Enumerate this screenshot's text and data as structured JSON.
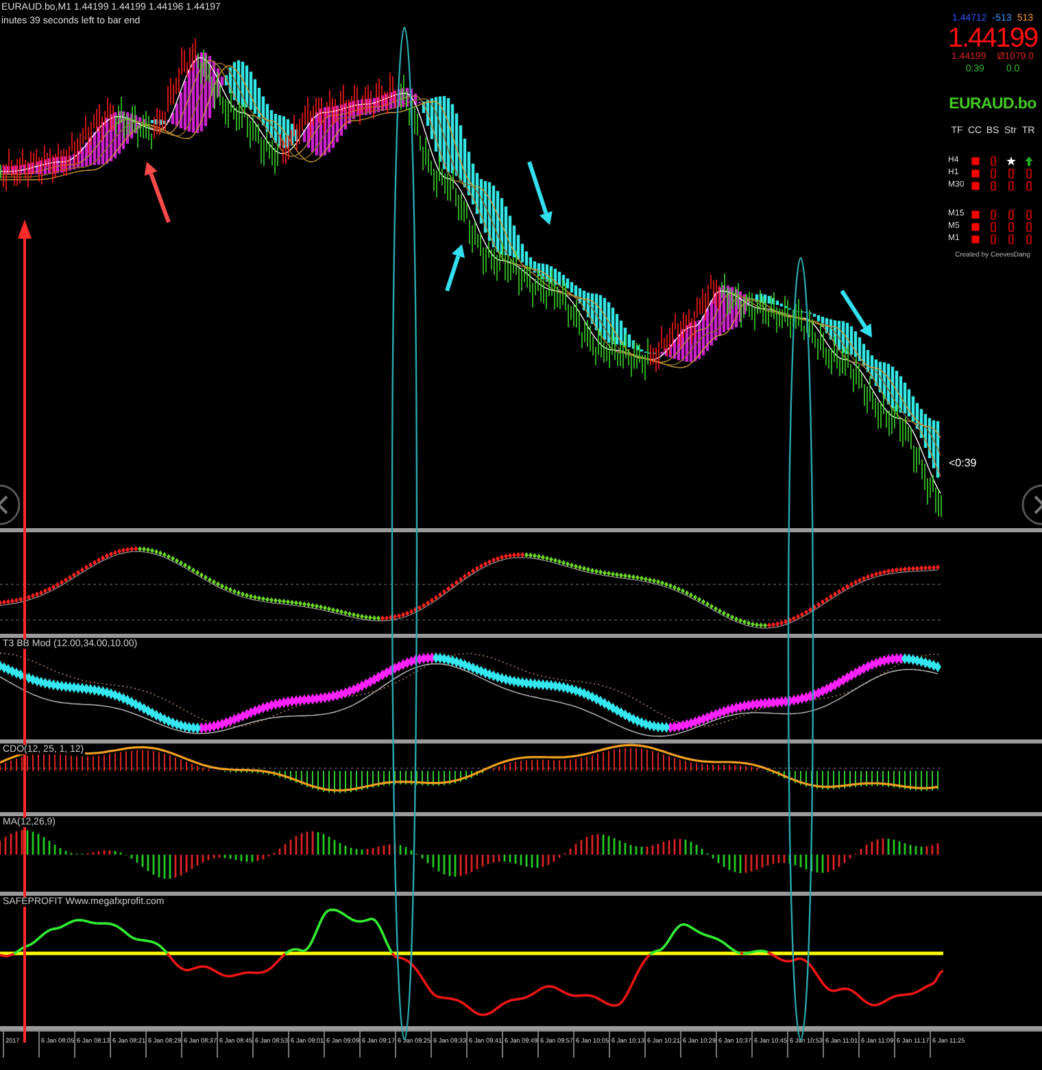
{
  "chart": {
    "symbol_line": "EURAUD.bo,M1  1.44199 1.44199 1.44196 1.44197",
    "timer_line": "inutes 39 seconds left to bar end",
    "countdown_label": "<0:39"
  },
  "info_panel": {
    "top_row": [
      "1.44712",
      "-513",
      "513"
    ],
    "price": "1.44199",
    "second_row": [
      "1.44199",
      "Ø1079.0"
    ],
    "third_row": [
      "0:39",
      "0.0"
    ],
    "symbol": "EURAUD.bo",
    "table": {
      "columns": [
        "TF",
        "CC",
        "BS",
        "Str",
        "TR"
      ],
      "groups": [
        [
          {
            "tf": "H4",
            "cells": [
              {
                "kind": "block",
                "color": "#ff0000"
              },
              {
                "kind": "mark",
                "color": "#cc0000"
              },
              {
                "kind": "star",
                "color": "#ffffff"
              },
              {
                "kind": "arrow",
                "color": "#22aa22"
              }
            ]
          },
          {
            "tf": "H1",
            "cells": [
              {
                "kind": "block",
                "color": "#ff0000"
              },
              {
                "kind": "mark",
                "color": "#cc0000"
              },
              {
                "kind": "mark",
                "color": "#cc0000"
              },
              {
                "kind": "mark",
                "color": "#cc0000"
              }
            ]
          },
          {
            "tf": "M30",
            "cells": [
              {
                "kind": "block",
                "color": "#ff0000"
              },
              {
                "kind": "mark",
                "color": "#cc0000"
              },
              {
                "kind": "mark",
                "color": "#cc0000"
              },
              {
                "kind": "mark",
                "color": "#cc0000"
              }
            ]
          }
        ],
        [
          {
            "tf": "M15",
            "cells": [
              {
                "kind": "block",
                "color": "#ff0000"
              },
              {
                "kind": "mark",
                "color": "#cc0000"
              },
              {
                "kind": "mark",
                "color": "#cc0000"
              },
              {
                "kind": "mark",
                "color": "#cc0000"
              }
            ]
          },
          {
            "tf": "M5",
            "cells": [
              {
                "kind": "block",
                "color": "#ff0000"
              },
              {
                "kind": "mark",
                "color": "#cc0000"
              },
              {
                "kind": "mark",
                "color": "#cc0000"
              },
              {
                "kind": "mark",
                "color": "#cc0000"
              }
            ]
          },
          {
            "tf": "M1",
            "cells": [
              {
                "kind": "block",
                "color": "#ff0000"
              },
              {
                "kind": "mark",
                "color": "#cc0000"
              },
              {
                "kind": "mark",
                "color": "#cc0000"
              },
              {
                "kind": "mark",
                "color": "#cc0000"
              }
            ]
          }
        ]
      ]
    },
    "credit": "Created by CeevesDang"
  },
  "indicators": [
    {
      "kind": "dots"
    },
    {
      "kind": "bands",
      "label": "T3 BB Mod (12.00,34.00,10.00)"
    },
    {
      "kind": "histogram-line",
      "label": "CDO(12, 25, 1, 12)"
    },
    {
      "kind": "histogram",
      "label": "MA(12,26,9)"
    },
    {
      "kind": "split-line",
      "label": "SAFEPROFIT  Www.megafxprofit.com"
    }
  ],
  "time_axis": [
    "2017",
    "6 Jan 08:05",
    "6 Jan 08:13",
    "6 Jan 08:21",
    "6 Jan 08:29",
    "6 Jan 08:37",
    "6 Jan 08:45",
    "6 Jan 08:53",
    "6 Jan 09:01",
    "6 Jan 09:09",
    "6 Jan 09:17",
    "6 Jan 09:25",
    "6 Jan 09:33",
    "6 Jan 09:41",
    "6 Jan 09:49",
    "6 Jan 09:57",
    "6 Jan 10:05",
    "6 Jan 10:13",
    "6 Jan 10:21",
    "6 Jan 10:29",
    "6 Jan 10:37",
    "6 Jan 10:45",
    "6 Jan 10:53",
    "6 Jan 11:01",
    "6 Jan 11:09",
    "6 Jan 11:17",
    "6 Jan 11:25"
  ]
}
